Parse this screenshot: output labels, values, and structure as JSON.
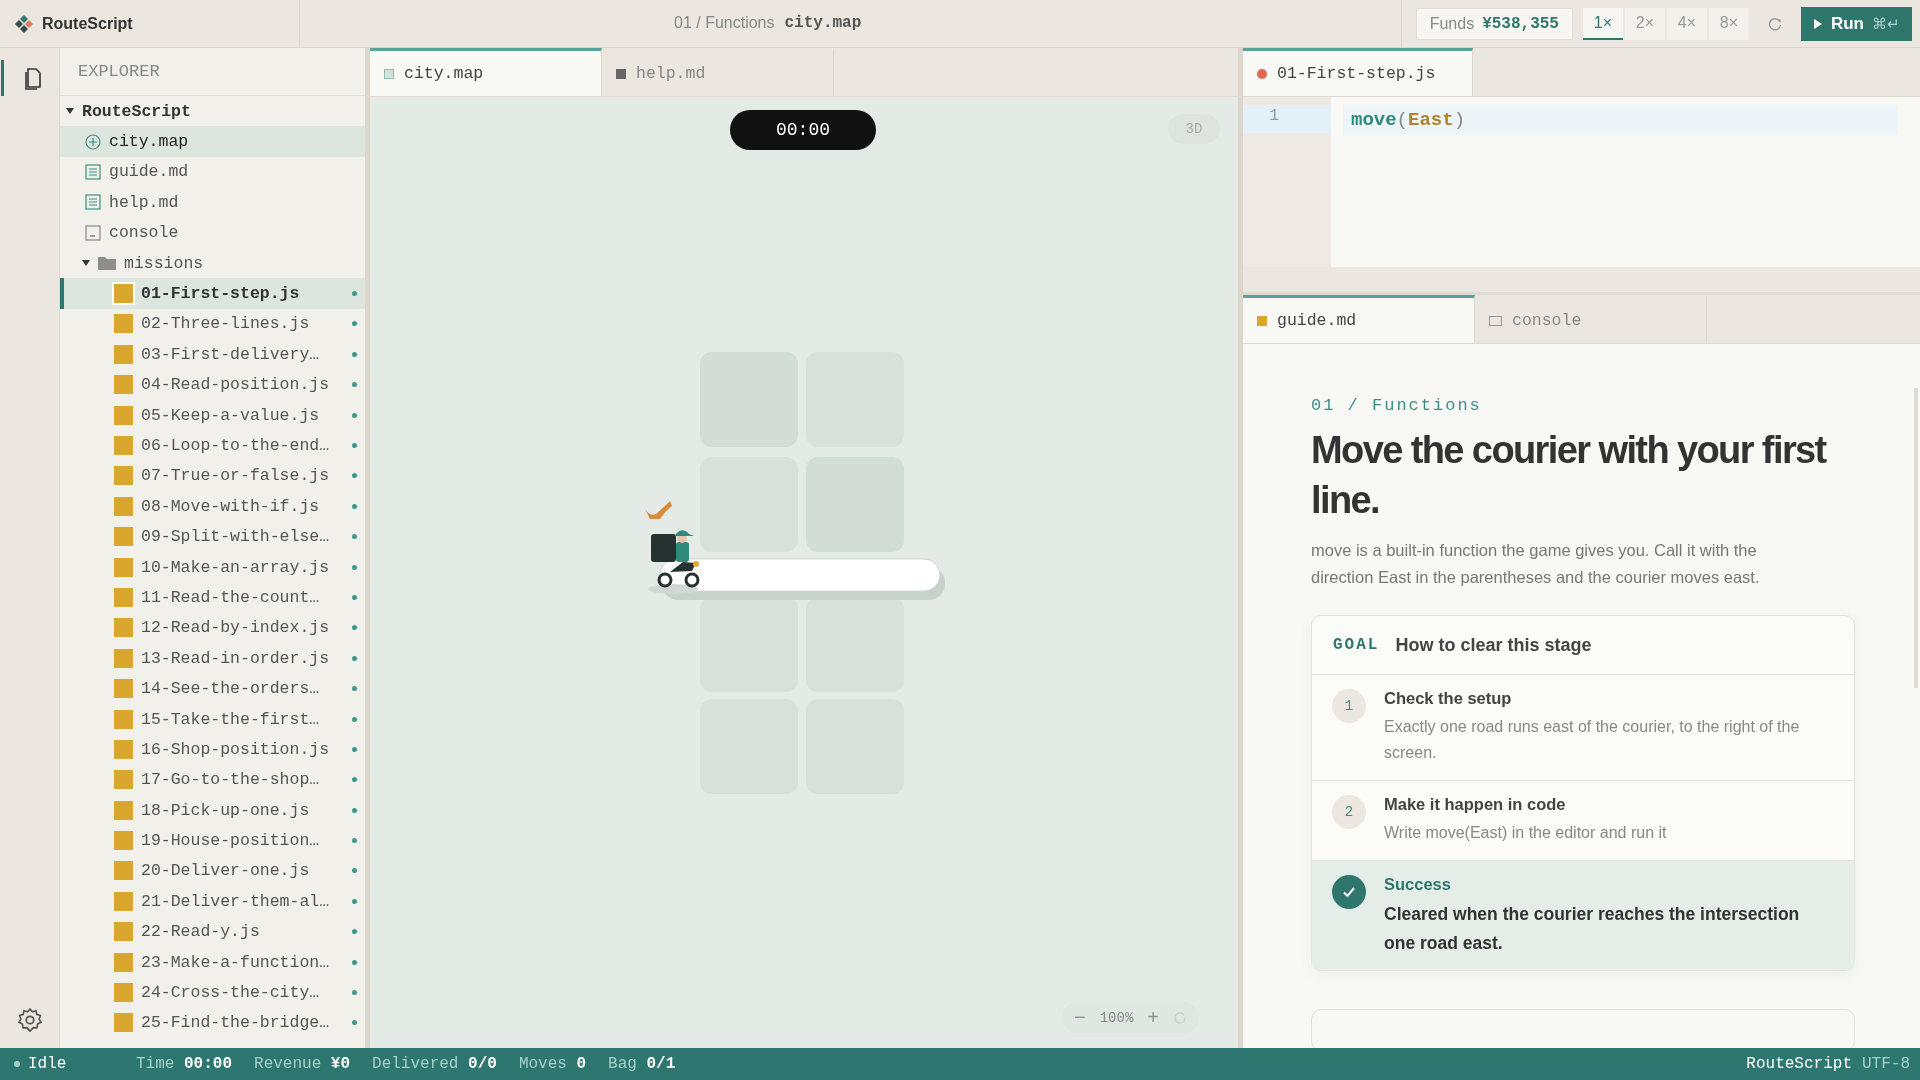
{
  "app": {
    "name": "RouteScript"
  },
  "breadcrumb": {
    "path": "01 / Functions",
    "file": "city.map"
  },
  "toolbar": {
    "funds_label": "Funds",
    "funds_value": "¥538,355",
    "speeds": [
      {
        "label": "1×",
        "selected": true
      },
      {
        "label": "2×",
        "selected": false
      },
      {
        "label": "4×",
        "selected": false
      },
      {
        "label": "8×",
        "selected": false
      }
    ],
    "run": {
      "label": "Run",
      "shortcut": "⌘↵"
    }
  },
  "explorer": {
    "title": "EXPLORER",
    "root": {
      "label": "RouteScript",
      "expanded": true,
      "children": [
        {
          "label": "city.map",
          "kind": "map",
          "selected": true
        },
        {
          "label": "guide.md",
          "kind": "doc",
          "selected": false
        },
        {
          "label": "help.md",
          "kind": "doc",
          "selected": false
        },
        {
          "label": "console",
          "kind": "console",
          "selected": false
        },
        {
          "label": "missions",
          "kind": "folder",
          "expanded": true,
          "children": [
            {
              "label": "01-First-step.js",
              "selected": true
            },
            {
              "label": "02-Three-lines.js",
              "selected": false
            },
            {
              "label": "03-First-delivery…",
              "selected": false
            },
            {
              "label": "04-Read-position.js",
              "selected": false
            },
            {
              "label": "05-Keep-a-value.js",
              "selected": false
            },
            {
              "label": "06-Loop-to-the-end…",
              "selected": false
            },
            {
              "label": "07-True-or-false.js",
              "selected": false
            },
            {
              "label": "08-Move-with-if.js",
              "selected": false
            },
            {
              "label": "09-Split-with-else…",
              "selected": false
            },
            {
              "label": "10-Make-an-array.js",
              "selected": false
            },
            {
              "label": "11-Read-the-count…",
              "selected": false
            },
            {
              "label": "12-Read-by-index.js",
              "selected": false
            },
            {
              "label": "13-Read-in-order.js",
              "selected": false
            },
            {
              "label": "14-See-the-orders…",
              "selected": false
            },
            {
              "label": "15-Take-the-first…",
              "selected": false
            },
            {
              "label": "16-Shop-position.js",
              "selected": false
            },
            {
              "label": "17-Go-to-the-shop…",
              "selected": false
            },
            {
              "label": "18-Pick-up-one.js",
              "selected": false
            },
            {
              "label": "19-House-position…",
              "selected": false
            },
            {
              "label": "20-Deliver-one.js",
              "selected": false
            },
            {
              "label": "21-Deliver-them-al…",
              "selected": false
            },
            {
              "label": "22-Read-y.js",
              "selected": false
            },
            {
              "label": "23-Make-a-function…",
              "selected": false
            },
            {
              "label": "24-Cross-the-city…",
              "selected": false
            },
            {
              "label": "25-Find-the-bridge…",
              "selected": false
            }
          ]
        }
      ]
    }
  },
  "map_tabs": [
    {
      "label": "city.map",
      "selected": true
    },
    {
      "label": "help.md",
      "selected": false
    }
  ],
  "map": {
    "timer": "00:00",
    "view_toggle": "3D",
    "zoom_out": "−",
    "zoom": "100%",
    "zoom_in": "+"
  },
  "editor": {
    "tab": {
      "label": "01-First-step.js",
      "modified": true
    },
    "lines": [
      {
        "number": "1",
        "tokens": [
          {
            "kind": "fn",
            "text": "move"
          },
          {
            "kind": "punct",
            "text": "("
          },
          {
            "kind": "const",
            "text": "East"
          },
          {
            "kind": "punct",
            "text": ")"
          }
        ]
      }
    ]
  },
  "doc_tabs": [
    {
      "label": "guide.md",
      "selected": true
    },
    {
      "label": "console",
      "selected": false
    }
  ],
  "guide": {
    "eyebrow": "01 / Functions",
    "title": "Move the courier with your first line.",
    "intro": "move is a built-in function the game gives you. Call it with the direction East in the parentheses and the courier moves east.",
    "goal": {
      "tag": "GOAL",
      "heading": "How to clear this stage",
      "steps": [
        {
          "kind": "step",
          "marker": "1",
          "title": "Check the setup",
          "text": "Exactly one road runs east of the courier, to the right of the screen."
        },
        {
          "kind": "step",
          "marker": "2",
          "title": "Make it happen in code",
          "text": "Write move(East) in the editor and run it"
        },
        {
          "kind": "success",
          "title": "Success",
          "text": "Cleared when the courier reaches the intersection one road east."
        }
      ]
    }
  },
  "status_bar": {
    "state": "Idle",
    "stats": [
      {
        "label": "Time",
        "value": "00:00"
      },
      {
        "label": "Revenue",
        "value": "¥0"
      },
      {
        "label": "Delivered",
        "value": "0/0"
      },
      {
        "label": "Moves",
        "value": "0"
      },
      {
        "label": "Bag",
        "value": "0/1"
      }
    ],
    "right": [
      "RouteScript",
      "UTF-8"
    ]
  }
}
